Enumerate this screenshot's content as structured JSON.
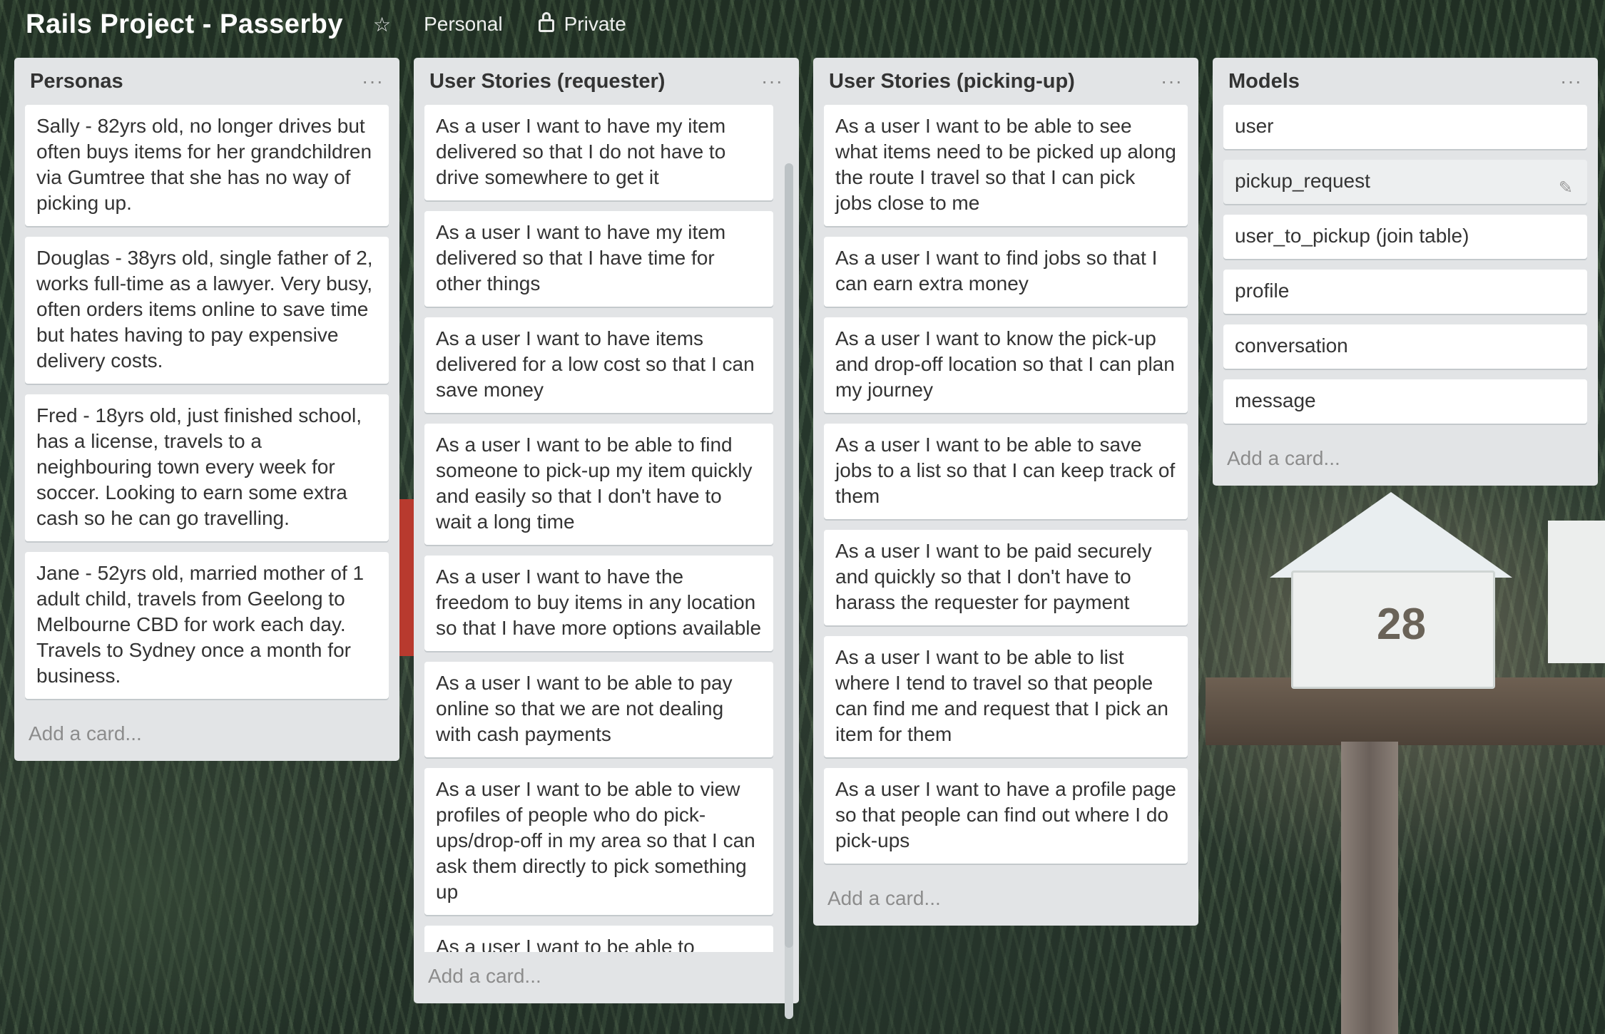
{
  "header": {
    "title": "Rails Project - Passerby",
    "star_icon": "star-icon",
    "team": "Personal",
    "visibility": "Private"
  },
  "lists": [
    {
      "title": "Personas",
      "menu": "···",
      "cards": [
        "Sally - 82yrs old, no longer drives but often buys items for her grandchildren via Gumtree that she has no way of picking up.",
        "Douglas - 38yrs old, single father of 2, works full-time as a lawyer. Very busy, often orders items online to save time but hates having to pay expensive delivery costs.",
        "Fred - 18yrs old, just finished school, has a license, travels to a neighbouring town every week for soccer. Looking to earn some extra cash so he can go travelling.",
        "Jane - 52yrs old, married mother of 1 adult child, travels from Geelong to Melbourne CBD for work each day. Travels to Sydney once a month for business."
      ],
      "add_card": "Add a card..."
    },
    {
      "title": "User Stories (requester)",
      "menu": "···",
      "cards": [
        "As a user I want to have my item delivered so that I do not have to drive somewhere to get it",
        "As a user I want to have my item delivered so that I have time for other things",
        "As a user I want to have items delivered for a low cost so that I can save money",
        "As a user I want to be able to find someone to pick-up my item quickly and easily so that I don't have to wait a long time",
        "As a user I want to have the freedom to buy items in any location so that I have more options available",
        "As a user I want to be able to pay online so that we are not dealing with cash payments",
        "As a user I want to be able to view profiles of people who do pick-ups/drop-off in my area so that I can ask them directly to pick something up",
        "As a user I want to be able to message the pick-up person"
      ],
      "add_card": "Add a card..."
    },
    {
      "title": "User Stories (picking-up)",
      "menu": "···",
      "cards": [
        "As a user I want to be able to see what items need to be picked up along the route I travel so that I can pick jobs close to me",
        "As a user I want to find jobs so that I can earn extra money",
        "As a user I want to know the pick-up and drop-off location so that I can plan my journey",
        "As a user I want to be able to save jobs to a list so that I can keep track of them",
        "As a user I want to be paid securely and quickly so that I don't have to harass the requester for payment",
        "As a user I want to be able to list where I tend to travel so that people can find me and request that I pick an item for them",
        "As a user I want to have a profile page so that people can find out where I do pick-ups"
      ],
      "add_card": "Add a card..."
    },
    {
      "title": "Models",
      "menu": "···",
      "cards": [
        "user",
        "pickup_request",
        "user_to_pickup (join table)",
        "profile",
        "conversation",
        "message"
      ],
      "add_card": "Add a card...",
      "edit_icon": "pencil-icon"
    }
  ],
  "scenery": {
    "mailbox_number": "28"
  }
}
